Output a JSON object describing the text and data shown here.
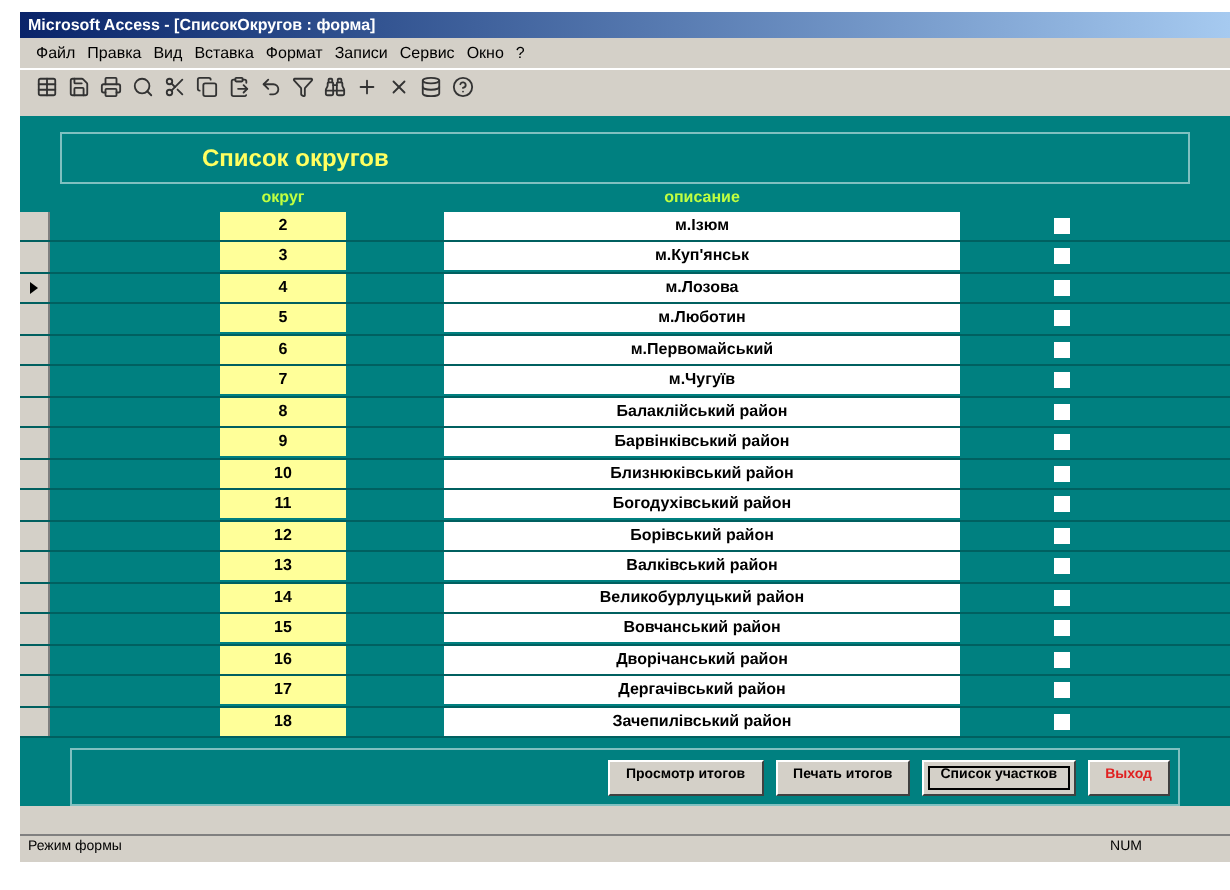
{
  "window": {
    "title": "Microsoft Access - [СписокОкругов : форма]"
  },
  "menu": [
    "Файл",
    "Правка",
    "Вид",
    "Вставка",
    "Формат",
    "Записи",
    "Сервис",
    "Окно",
    "?"
  ],
  "form": {
    "title": "Список округов",
    "columns": [
      "округ",
      "описание"
    ],
    "rows": [
      {
        "number": "2",
        "name": "м.Ізюм",
        "checked": false,
        "selected": false
      },
      {
        "number": "3",
        "name": "м.Куп'янськ",
        "checked": false,
        "selected": false
      },
      {
        "number": "4",
        "name": "м.Лозова",
        "checked": false,
        "selected": true
      },
      {
        "number": "5",
        "name": "м.Люботин",
        "checked": false,
        "selected": false
      },
      {
        "number": "6",
        "name": "м.Первомайський",
        "checked": false,
        "selected": false
      },
      {
        "number": "7",
        "name": "м.Чугуїв",
        "checked": false,
        "selected": false
      },
      {
        "number": "8",
        "name": "Балаклійський район",
        "checked": false,
        "selected": false
      },
      {
        "number": "9",
        "name": "Барвінківський район",
        "checked": false,
        "selected": false
      },
      {
        "number": "10",
        "name": "Близнюківський район",
        "checked": false,
        "selected": false
      },
      {
        "number": "11",
        "name": "Богодухівський район",
        "checked": false,
        "selected": false
      },
      {
        "number": "12",
        "name": "Борівський район",
        "checked": false,
        "selected": false
      },
      {
        "number": "13",
        "name": "Валківський район",
        "checked": false,
        "selected": false
      },
      {
        "number": "14",
        "name": "Великобурлуцький район",
        "checked": false,
        "selected": false
      },
      {
        "number": "15",
        "name": "Вовчанський район",
        "checked": false,
        "selected": false
      },
      {
        "number": "16",
        "name": "Дворічанський район",
        "checked": false,
        "selected": false
      },
      {
        "number": "17",
        "name": "Дергачівський район",
        "checked": false,
        "selected": false
      },
      {
        "number": "18",
        "name": "Зачепилівський район",
        "checked": false,
        "selected": false
      }
    ],
    "buttons": [
      {
        "label": "Просмотр итогов",
        "kind": "normal"
      },
      {
        "label": "Печать итогов",
        "kind": "normal"
      },
      {
        "label": "Список участков",
        "kind": "focused"
      },
      {
        "label": "Выход",
        "kind": "danger"
      }
    ]
  },
  "status_bar": {
    "mode": "Режим формы",
    "indicator": "NUM"
  }
}
